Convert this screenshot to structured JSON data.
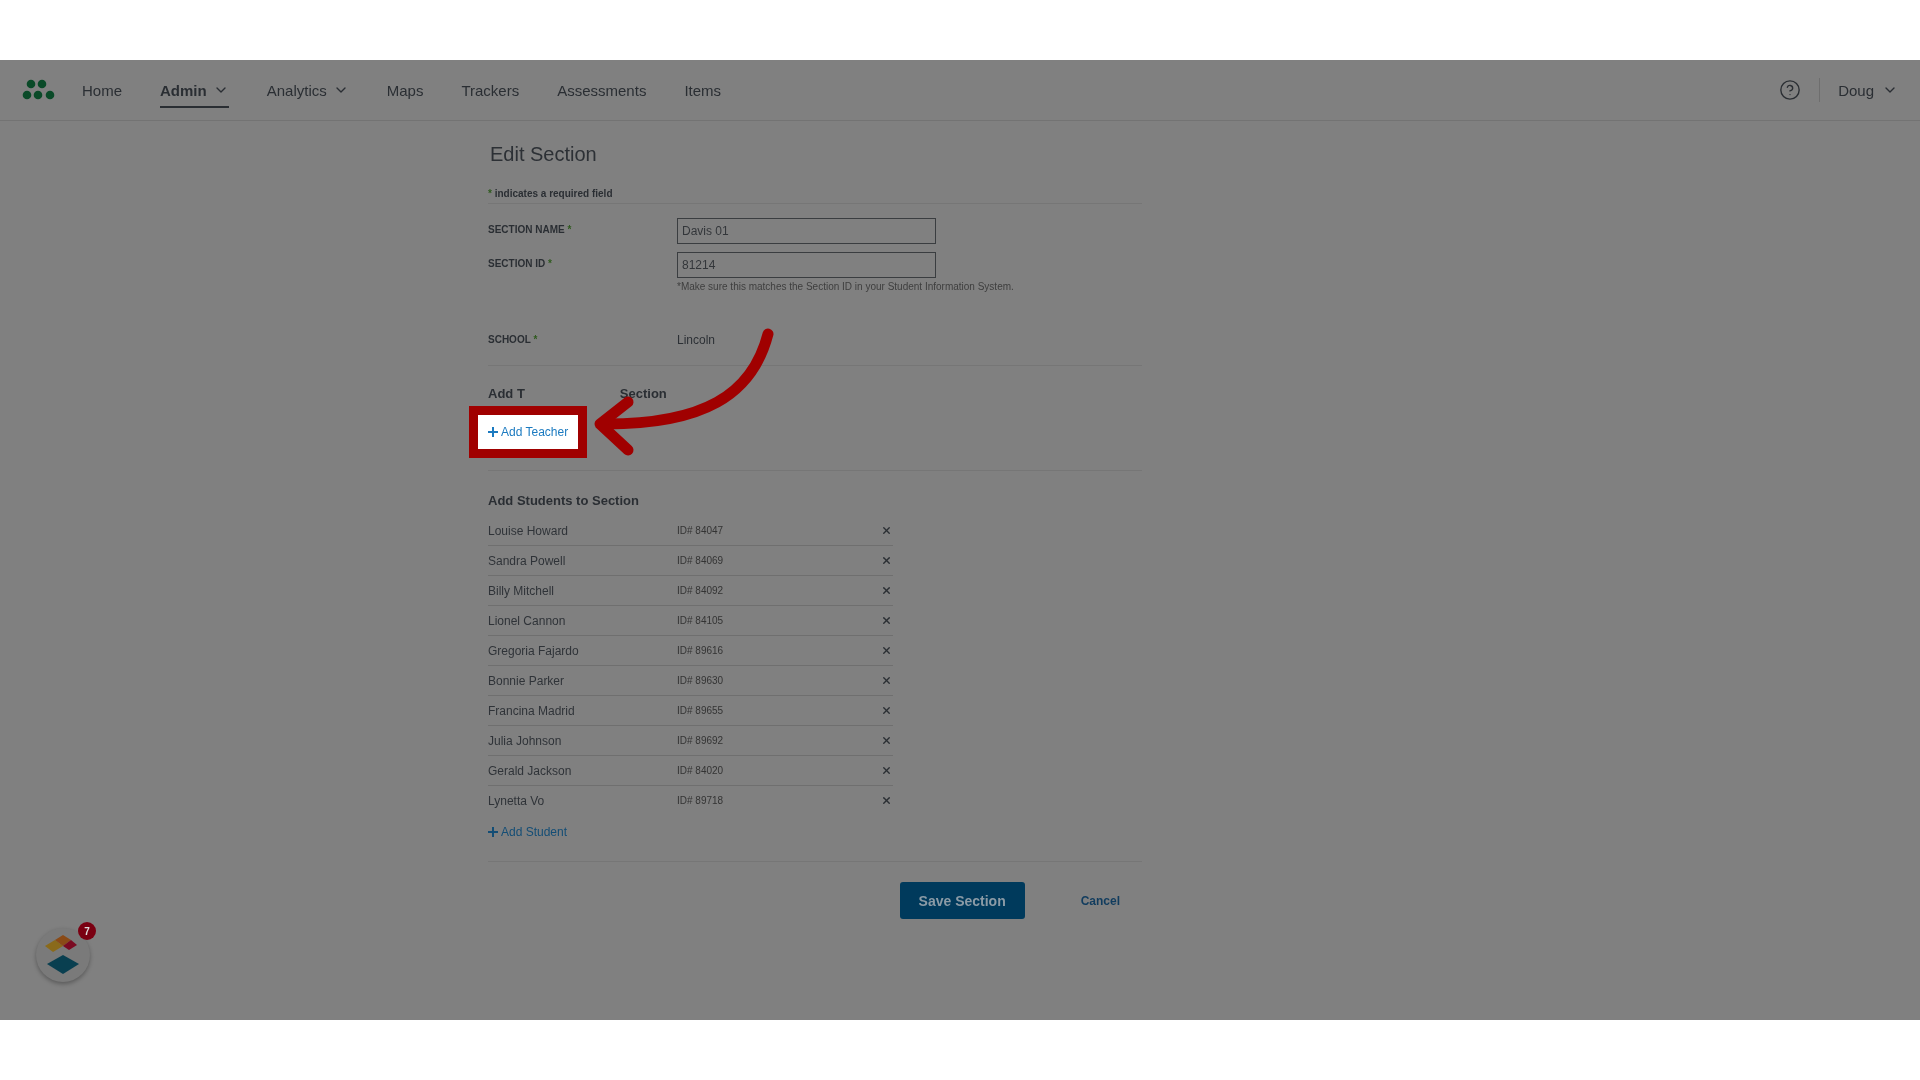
{
  "nav": {
    "items": [
      {
        "label": "Home",
        "selected": false,
        "dropdown": false
      },
      {
        "label": "Admin",
        "selected": true,
        "dropdown": true
      },
      {
        "label": "Analytics",
        "selected": false,
        "dropdown": true
      },
      {
        "label": "Maps",
        "selected": false,
        "dropdown": false
      },
      {
        "label": "Trackers",
        "selected": false,
        "dropdown": false
      },
      {
        "label": "Assessments",
        "selected": false,
        "dropdown": false
      },
      {
        "label": "Items",
        "selected": false,
        "dropdown": false
      }
    ],
    "user": "Doug"
  },
  "form": {
    "title": "Edit Section",
    "required_note": {
      "mark": "*",
      "text": "indicates a required field"
    },
    "fields": [
      {
        "kind": "input",
        "label": "SECTION NAME",
        "required_mark": "*",
        "value": "Davis 01"
      },
      {
        "kind": "input",
        "label": "SECTION ID",
        "required_mark": "*",
        "value": "81214",
        "hint": "*Make sure this matches the Section ID in your Student Information System."
      },
      {
        "kind": "text",
        "label": "SCHOOL",
        "required_mark": "*",
        "value": "Lincoln"
      }
    ]
  },
  "teachers": {
    "heading_parts": [
      "Add T",
      "Section"
    ],
    "add_button": "Add Teacher",
    "highlighted": true
  },
  "students": {
    "heading": "Add Students to Section",
    "rows": [
      {
        "name": "Louise Howard",
        "id": "ID# 84047"
      },
      {
        "name": "Sandra Powell",
        "id": "ID# 84069"
      },
      {
        "name": "Billy Mitchell",
        "id": "ID# 84092"
      },
      {
        "name": "Lionel Cannon",
        "id": "ID# 84105"
      },
      {
        "name": "Gregoria Fajardo",
        "id": "ID# 89616"
      },
      {
        "name": "Bonnie Parker",
        "id": "ID# 89630"
      },
      {
        "name": "Francina Madrid",
        "id": "ID# 89655"
      },
      {
        "name": "Julia Johnson",
        "id": "ID# 89692"
      },
      {
        "name": "Gerald Jackson",
        "id": "ID# 84020"
      },
      {
        "name": "Lynetta Vo",
        "id": "ID# 89718"
      }
    ],
    "add_button": "Add Student"
  },
  "actions": {
    "save": "Save Section",
    "cancel": "Cancel"
  },
  "widget": {
    "badge": "7"
  }
}
